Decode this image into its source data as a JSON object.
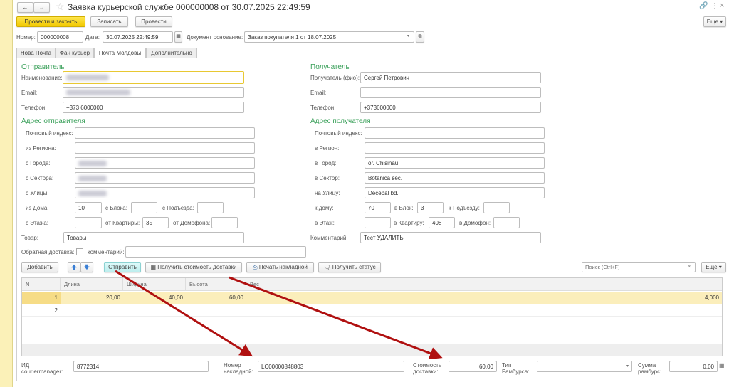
{
  "window": {
    "title": "Заявка курьерской службе 000000008 от 30.07.2025 22:49:59"
  },
  "toolbar": {
    "post_close": "Провести и закрыть",
    "save": "Записать",
    "post": "Провести",
    "more": "Еще"
  },
  "header": {
    "number_label": "Номер:",
    "number": "000000008",
    "date_label": "Дата:",
    "date": "30.07.2025 22:49:59",
    "basis_label": "Документ основание:",
    "basis": "Заказ покупателя 1 от 18.07.2025"
  },
  "tabs": [
    {
      "label": "Нова Почта"
    },
    {
      "label": "Фан курьер"
    },
    {
      "label": "Почта Молдовы",
      "active": true
    },
    {
      "label": "Дополнительно"
    }
  ],
  "sender": {
    "heading": "Отправитель",
    "name_label": "Наименование:",
    "email_label": "Email:",
    "phone_label": "Телефон:",
    "phone": "+373 6000000",
    "address_heading": "Адрес отправителя",
    "postcode_label": "Почтовый индекс:",
    "region_label": "из Региона:",
    "city_label": "с Города:",
    "sector_label": "с Сектора:",
    "street_label": "с Улицы:",
    "house_label": "из Дома:",
    "house": "10",
    "block_label": "с Блока:",
    "entrance_label": "с Подъезда:",
    "floor_label": "с Этажа:",
    "apt_label": "от Квартиры:",
    "apt": "35",
    "intercom_label": "от Домофона:",
    "goods_label": "Товар:",
    "goods": "Товары",
    "return_label": "Обратная доставка:",
    "comment_label": "комментарий:"
  },
  "receiver": {
    "heading": "Получатель",
    "name_label": "Получатель (фио):",
    "name": "Сергей Петрович",
    "email_label": "Email:",
    "phone_label": "Телефон:",
    "phone": "+373600000",
    "address_heading": "Адрес получателя",
    "postcode_label": "Почтовый индекс:",
    "region_label": "в Регион:",
    "city_label": "в Город:",
    "city": "or. Chisinau",
    "sector_label": "в Сектор:",
    "sector": "Botanica sec.",
    "street_label": "на Улицу:",
    "street": "Decebal bd.",
    "house_label": "к дому:",
    "house": "70",
    "block_label": "в Блок:",
    "block": "3",
    "entrance_label": "к Подъезду:",
    "floor_label": "в Этаж:",
    "apt_label": "в Квартиру:",
    "apt": "408",
    "intercom_label": "в Домофон:",
    "comment_label": "Комментарий:",
    "comment": "Тест УДАЛИТЬ"
  },
  "table_toolbar": {
    "add": "Добавить",
    "send": "Отправить",
    "get_cost": "Получить стоимость доставки",
    "print": "Печать накладной",
    "status": "Получить статус",
    "search_placeholder": "Поиск (Ctrl+F)",
    "more": "Еще"
  },
  "table": {
    "columns": [
      "N",
      "Длина",
      "Ширина",
      "Высота",
      "Вес"
    ],
    "rows": [
      [
        "1",
        "20,00",
        "40,00",
        "60,00",
        "4,000"
      ],
      [
        "2",
        "",
        "",
        "",
        ""
      ]
    ]
  },
  "footer": {
    "id_label": "ИД couriermanager:",
    "id": "8772314",
    "waybill_label": "Номер накладной:",
    "waybill": "LC00000848803",
    "cost_label": "Стоимость доставки:",
    "cost": "60,00",
    "reimb_type_label": "Тип Рамбурса:",
    "reimb_sum_label": "Сумма рамбурс:",
    "reimb_sum": "0,00"
  },
  "colors": {
    "accent_yellow": "#f5d214",
    "heading_green": "#3aa05a",
    "send_button": "#c9f3f3",
    "arrow": "#b01010"
  }
}
